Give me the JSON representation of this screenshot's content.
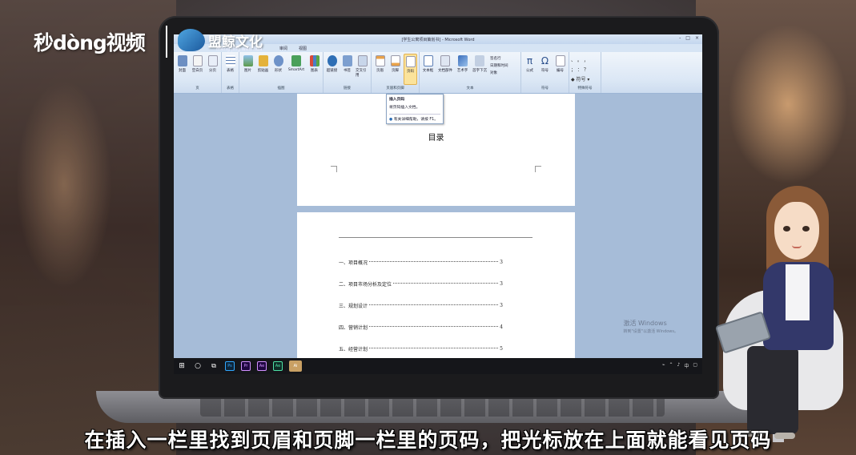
{
  "overlay": {
    "logo_miaodong": "秒dòng视频",
    "logo_mengjing": "盟鲸文化",
    "logo_mengjing_sub": "meng jing wen hua",
    "subtitle": "在插入一栏里找到页眉和页脚一栏里的页码，把光标放在上面就能看见页码"
  },
  "app": {
    "title": "[学生公寓项目策划书] - Microsoft Word",
    "tabs": [
      "审阅",
      "视图"
    ],
    "window_controls": [
      "-",
      "□",
      "×"
    ]
  },
  "ribbon": {
    "groups": [
      {
        "label": "页",
        "buttons": [
          "封面",
          "空白页",
          "分页"
        ]
      },
      {
        "label": "表格",
        "buttons": [
          "表格"
        ]
      },
      {
        "label": "插图",
        "buttons": [
          "图片",
          "剪贴画",
          "形状",
          "SmartArt",
          "图表"
        ]
      },
      {
        "label": "链接",
        "buttons": [
          "超链接",
          "书签",
          "交叉引用"
        ]
      },
      {
        "label": "页眉和页脚",
        "buttons": [
          "页眉",
          "页脚",
          "页码"
        ]
      },
      {
        "label": "文本",
        "buttons": [
          "文本框",
          "文档部件",
          "艺术字",
          "首字下沉"
        ],
        "small": [
          "签名行",
          "日期和时间",
          "对象"
        ]
      },
      {
        "label": "符号",
        "buttons": [
          "公式",
          "符号",
          "编号"
        ]
      },
      {
        "label": "特殊符号",
        "buttons": []
      }
    ]
  },
  "tooltip": {
    "title": "插入页码",
    "desc": "将页码插入文档。",
    "help": "有关详细帮助，请按 F1。"
  },
  "document": {
    "page1_title": "目录",
    "toc": [
      {
        "label": "一、项目概况",
        "page": "3"
      },
      {
        "label": "二、项目市场分析及定位",
        "page": "3"
      },
      {
        "label": "三、规划设计",
        "page": "3"
      },
      {
        "label": "四、营销计划",
        "page": "4"
      },
      {
        "label": "五、经营计划",
        "page": "5"
      }
    ]
  },
  "taskbar": {
    "apps": [
      "Ps",
      "Pr",
      "Ae",
      "Ae",
      "Ai"
    ]
  },
  "activation_watermark": {
    "line1": "激活 Windows",
    "line2": "转到\"设置\"以激活 Windows。"
  },
  "colors": {
    "ribbon_bg": "#dbe7f5",
    "doc_bg": "#a6bcd8",
    "active_button": "#fbe39b",
    "taskbar": "#15161a"
  }
}
